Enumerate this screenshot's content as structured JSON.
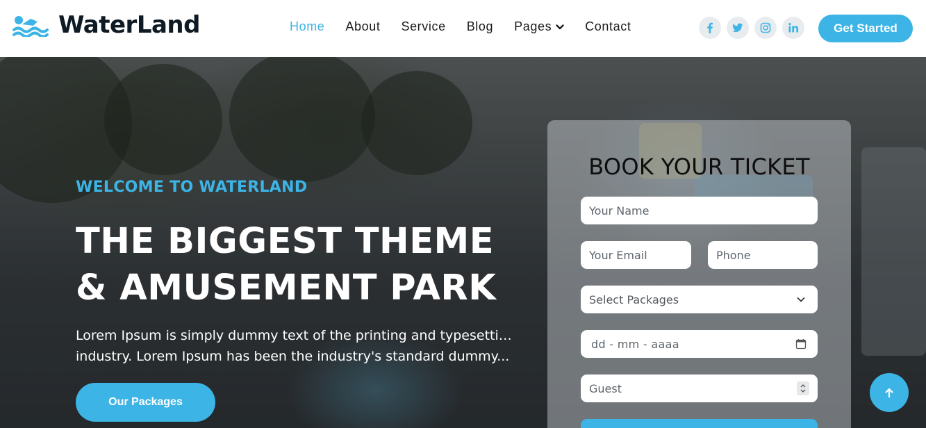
{
  "brand": {
    "name": "WaterLand",
    "icon": "swimmer-icon"
  },
  "nav": {
    "items": [
      {
        "label": "Home",
        "active": true
      },
      {
        "label": "About"
      },
      {
        "label": "Service"
      },
      {
        "label": "Blog"
      },
      {
        "label": "Pages",
        "dropdown": true
      },
      {
        "label": "Contact"
      }
    ]
  },
  "socials": [
    "facebook-icon",
    "twitter-icon",
    "instagram-icon",
    "linkedin-icon"
  ],
  "header_cta": "Get Started",
  "hero": {
    "eyebrow": "WELCOME TO WATERLAND",
    "headline_line1": "THE BIGGEST THEME",
    "headline_line2": "& AMUSEMENT PARK",
    "lead_line1": "Lorem Ipsum is simply dummy text of the printing and typesetting",
    "lead_line2": "industry. Lorem Ipsum has been the industry's standard dummy...",
    "button": "Our Packages"
  },
  "booking": {
    "title": "BOOK YOUR TICKET",
    "name_placeholder": "Your Name",
    "email_placeholder": "Your Email",
    "phone_placeholder": "Phone",
    "package_value": "Select Packages",
    "date_placeholder": "dd - mm - aaaa",
    "guest_placeholder": "Guest"
  },
  "colors": {
    "accent": "#3cb4e5",
    "dark": "#0e1a24"
  }
}
